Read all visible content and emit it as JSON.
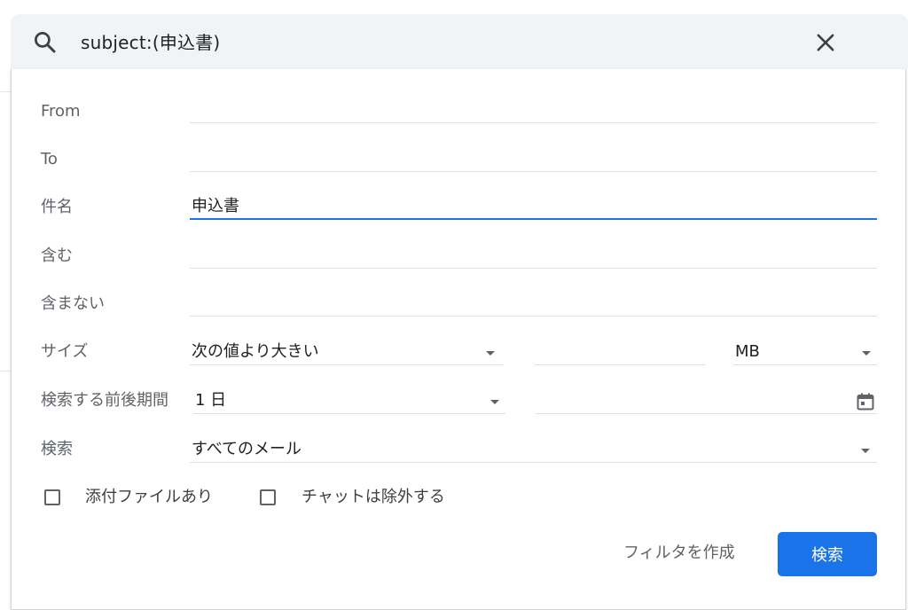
{
  "search": {
    "query": "subject:(申込書)",
    "search_icon": "search-icon",
    "close_icon": "close-icon"
  },
  "form": {
    "from": {
      "label": "From",
      "value": ""
    },
    "to": {
      "label": "To",
      "value": ""
    },
    "subject": {
      "label": "件名",
      "value": "申込書"
    },
    "has_words": {
      "label": "含む",
      "value": ""
    },
    "doesnt_have": {
      "label": "含まない",
      "value": ""
    },
    "size": {
      "label": "サイズ",
      "comparator": "次の値より大きい",
      "amount": "",
      "unit": "MB"
    },
    "date_within": {
      "label": "検索する前後期間",
      "range": "1 日",
      "date": "",
      "icon": "calendar-icon"
    },
    "search_in": {
      "label": "検索",
      "value": "すべてのメール"
    },
    "has_attachment": {
      "label": "添付ファイルあり",
      "checked": false
    },
    "exclude_chats": {
      "label": "チャットは除外する",
      "checked": false
    }
  },
  "actions": {
    "create_filter": "フィルタを作成",
    "search_button": "検索"
  },
  "colors": {
    "accent": "#1a73e8",
    "searchbar_bg": "#f1f3f4",
    "label_gray": "#5f6368"
  }
}
